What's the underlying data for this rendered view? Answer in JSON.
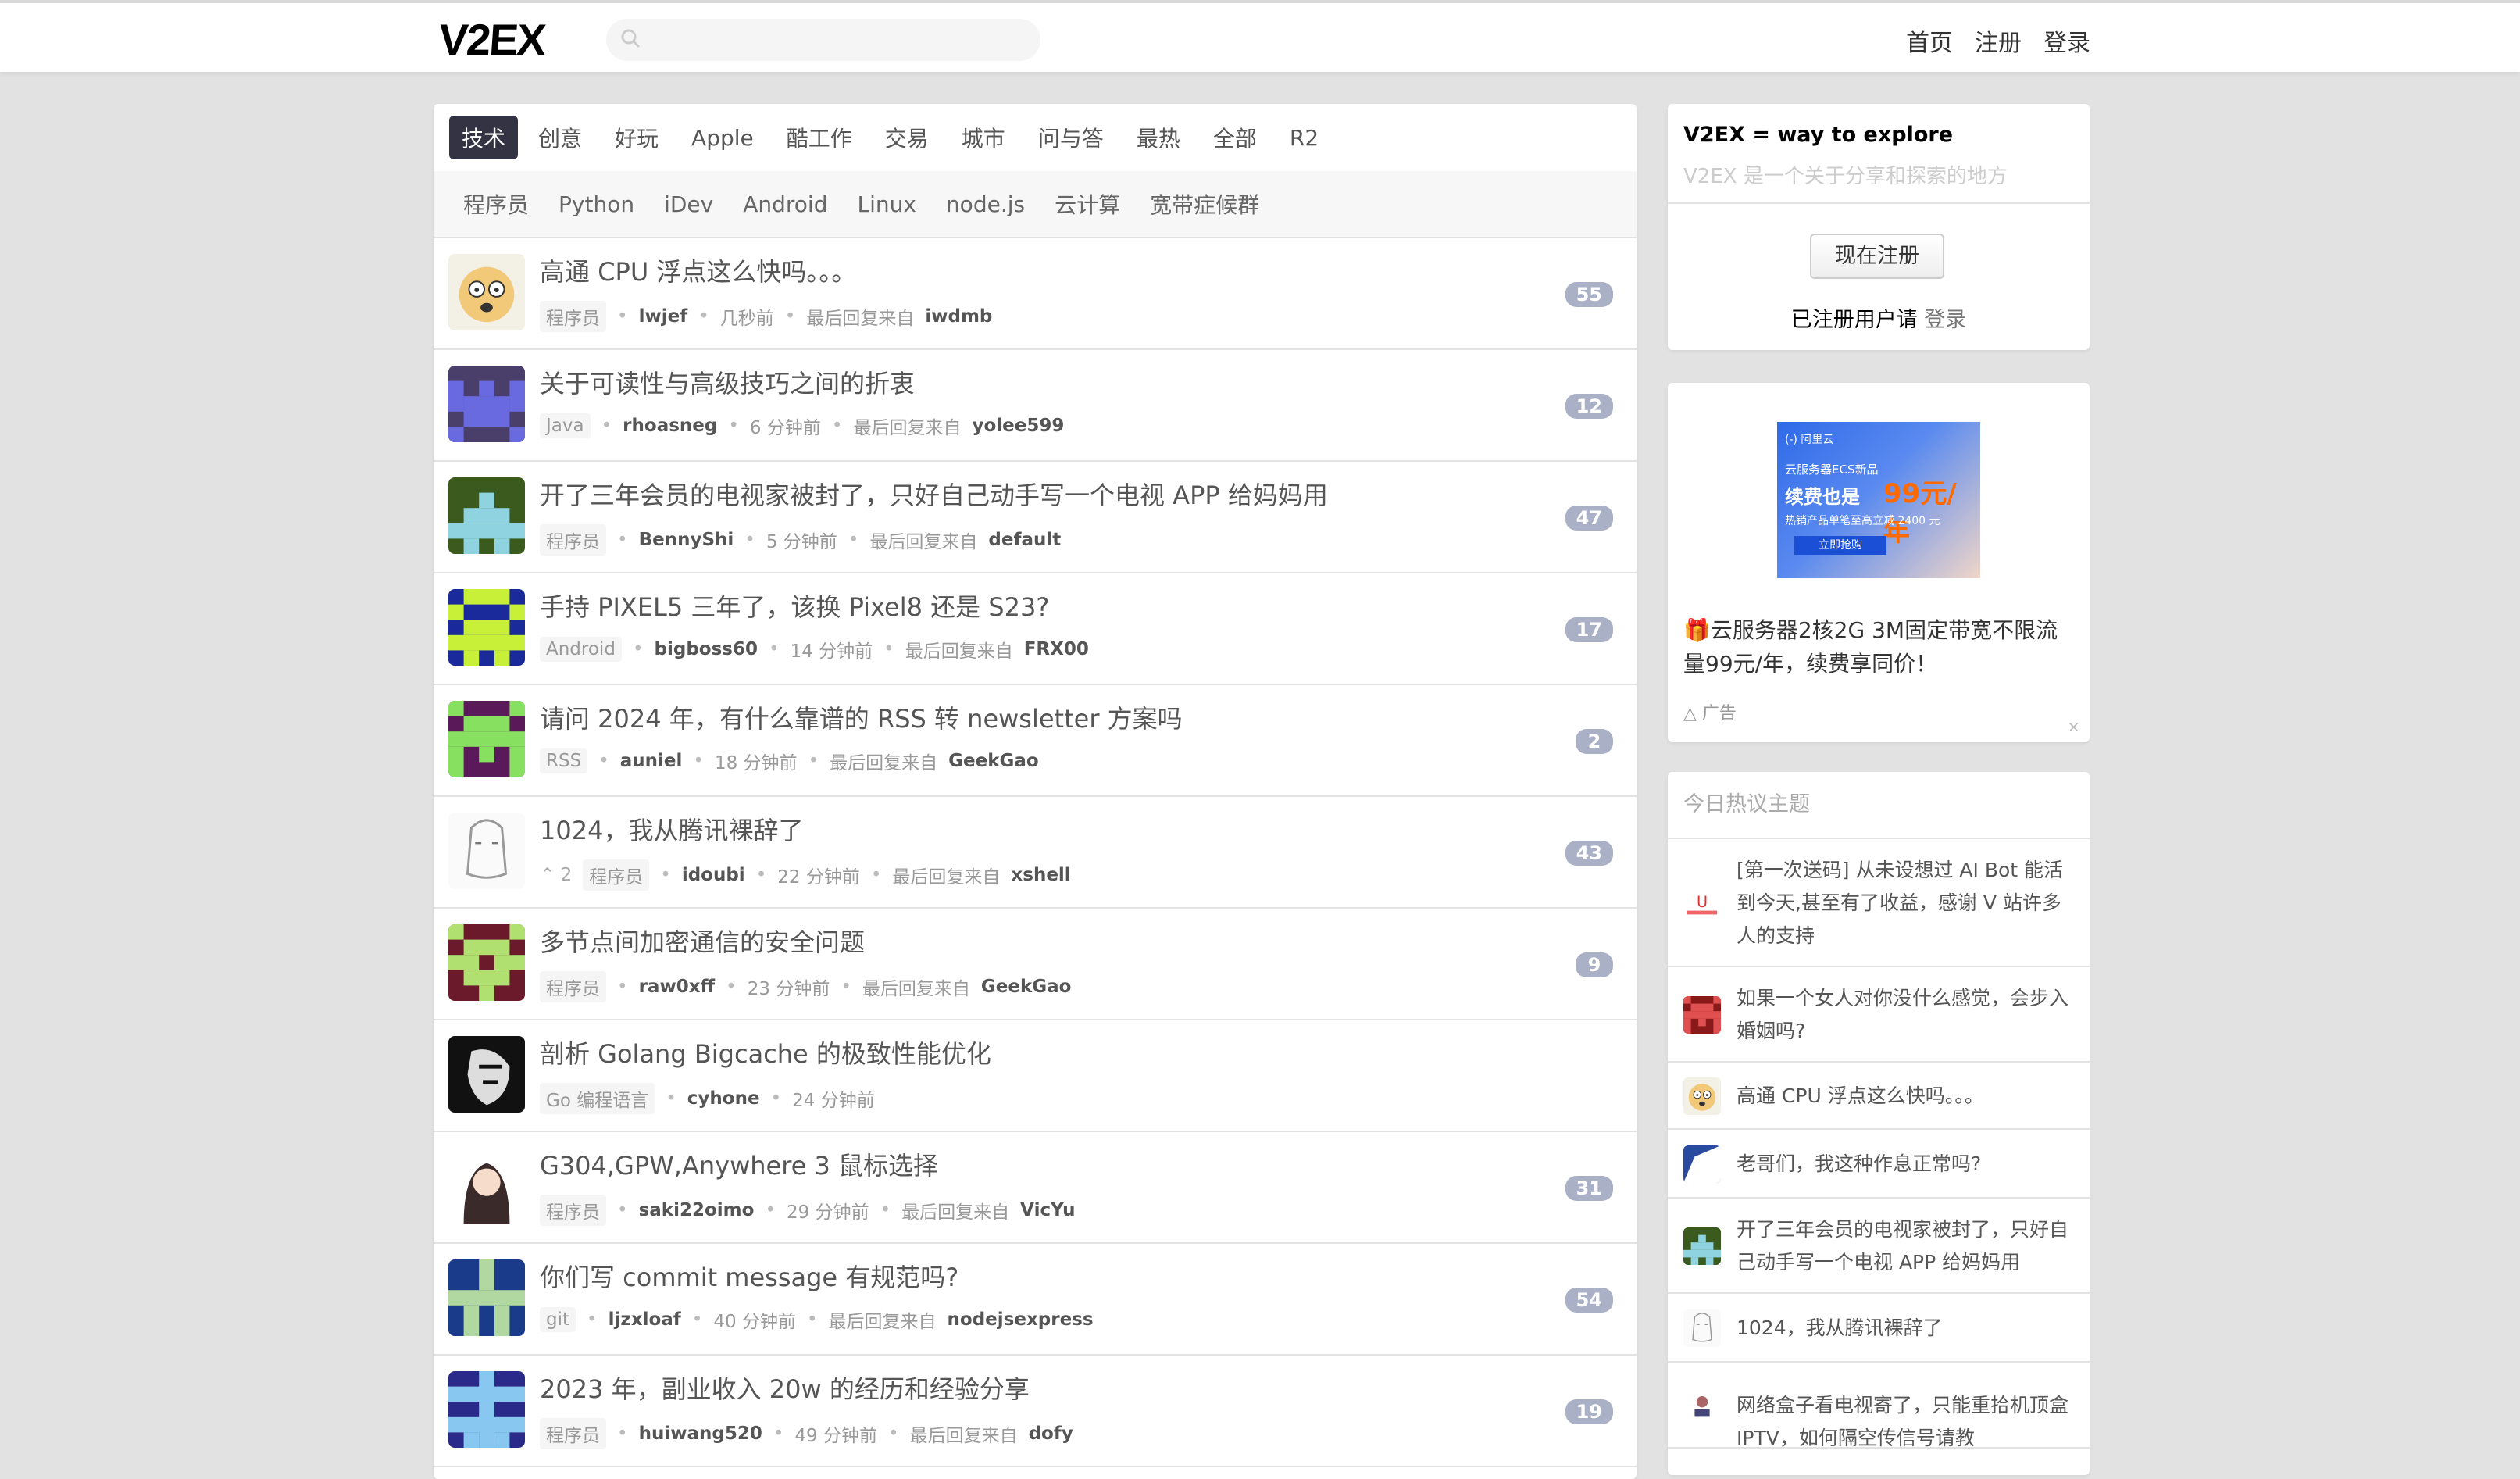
{
  "header": {
    "logo": "V2EX",
    "nav": [
      "首页",
      "注册",
      "登录"
    ]
  },
  "tabs": [
    "技术",
    "创意",
    "好玩",
    "Apple",
    "酷工作",
    "交易",
    "城市",
    "问与答",
    "最热",
    "全部",
    "R2"
  ],
  "subtabs": [
    "程序员",
    "Python",
    "iDev",
    "Android",
    "Linux",
    "node.js",
    "云计算",
    "宽带症候群"
  ],
  "topics": [
    {
      "title": "高通 CPU 浮点这么快吗。。。",
      "node": "程序员",
      "author": "lwjef",
      "time": "几秒前",
      "last_label": "最后回复来自",
      "last": "iwdmb",
      "count": "55",
      "votes": ""
    },
    {
      "title": "关于可读性与高级技巧之间的折衷",
      "node": "Java",
      "author": "rhoasneg",
      "time": "6 分钟前",
      "last_label": "最后回复来自",
      "last": "yolee599",
      "count": "12",
      "votes": ""
    },
    {
      "title": "开了三年会员的电视家被封了，只好自己动手写一个电视 APP 给妈妈用",
      "node": "程序员",
      "author": "BennyShi",
      "time": "5 分钟前",
      "last_label": "最后回复来自",
      "last": "default",
      "count": "47",
      "votes": ""
    },
    {
      "title": "手持 PIXEL5 三年了，该换 Pixel8 还是 S23?",
      "node": "Android",
      "author": "bigboss60",
      "time": "14 分钟前",
      "last_label": "最后回复来自",
      "last": "FRX00",
      "count": "17",
      "votes": ""
    },
    {
      "title": "请问 2024 年，有什么靠谱的 RSS 转 newsletter 方案吗",
      "node": "RSS",
      "author": "auniel",
      "time": "18 分钟前",
      "last_label": "最后回复来自",
      "last": "GeekGao",
      "count": "2",
      "votes": ""
    },
    {
      "title": "1024，我从腾讯裸辞了",
      "node": "程序员",
      "author": "idoubi",
      "time": "22 分钟前",
      "last_label": "最后回复来自",
      "last": "xshell",
      "count": "43",
      "votes": "2"
    },
    {
      "title": "多节点间加密通信的安全问题",
      "node": "程序员",
      "author": "raw0xff",
      "time": "23 分钟前",
      "last_label": "最后回复来自",
      "last": "GeekGao",
      "count": "9",
      "votes": ""
    },
    {
      "title": "剖析 Golang Bigcache 的极致性能优化",
      "node": "Go 编程语言",
      "author": "cyhone",
      "time": "24 分钟前",
      "last_label": "",
      "last": "",
      "count": "",
      "votes": ""
    },
    {
      "title": "G304,GPW,Anywhere 3 鼠标选择",
      "node": "程序员",
      "author": "saki22oimo",
      "time": "29 分钟前",
      "last_label": "最后回复来自",
      "last": "VicYu",
      "count": "31",
      "votes": ""
    },
    {
      "title": "你们写 commit message 有规范吗?",
      "node": "git",
      "author": "ljzxloaf",
      "time": "40 分钟前",
      "last_label": "最后回复来自",
      "last": "nodejsexpress",
      "count": "54",
      "votes": ""
    },
    {
      "title": "2023 年，副业收入 20w 的经历和经验分享",
      "node": "程序员",
      "author": "huiwang520",
      "time": "49 分钟前",
      "last_label": "最后回复来自",
      "last": "dofy",
      "count": "19",
      "votes": ""
    }
  ],
  "sidebar": {
    "title": "V2EX = way to explore",
    "subtitle": "V2EX 是一个关于分享和探索的地方",
    "register_btn": "现在注册",
    "login_prompt": "已注册用户请",
    "login_link": "登录",
    "ad": {
      "logo": "(-) 阿里云",
      "line1": "云服务器ECS新品",
      "line2": "续费也是",
      "price": "99元/年",
      "line3": "热销产品单笔至高立减 2400 元",
      "button": "立即抢购",
      "text": "🎁云服务器2核2G 3M固定带宽不限流量99元/年，续费享同价！",
      "label": "广告",
      "close": "×"
    },
    "hot_title": "今日热议主题",
    "hot": [
      "[第一次送码] 从未设想过 AI Bot 能活到今天,甚至有了收益，感谢 V 站许多人的支持",
      "如果一个女人对你没什么感觉，会步入婚姻吗?",
      "高通 CPU 浮点这么快吗。。。",
      "老哥们，我这种作息正常吗?",
      "开了三年会员的电视家被封了，只好自己动手写一个电视 APP 给妈妈用",
      "1024，我从腾讯裸辞了",
      "网络盒子看电视寄了，只能重拾机顶盒 IPTV，如何隔空传信号请教"
    ]
  },
  "colors": {
    "accent_tab": "#333344",
    "count_badge": "#aab0c6",
    "page_bg": "#e2e2e2"
  }
}
